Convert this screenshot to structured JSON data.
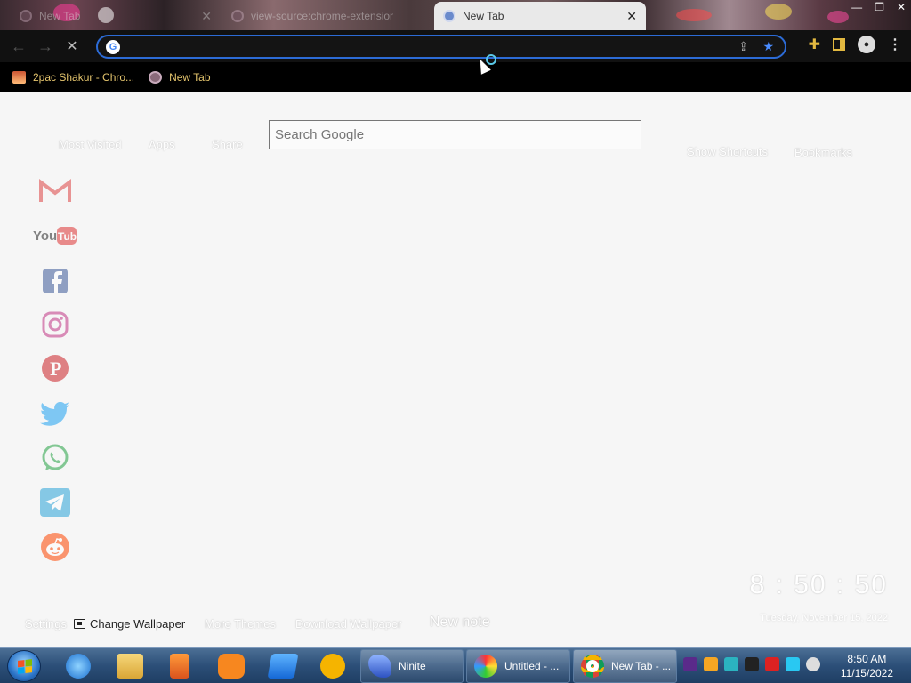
{
  "tabs": [
    {
      "label": "New Tab",
      "state": "inactive"
    },
    {
      "label": "view-source:chrome-extension://",
      "state": "inactive"
    },
    {
      "label": "New Tab",
      "state": "active"
    }
  ],
  "omnibox": {
    "value": "",
    "placeholder": ""
  },
  "bookmarks": [
    {
      "label": "2pac Shakur - Chro..."
    },
    {
      "label": "New Tab"
    }
  ],
  "page": {
    "top_links": {
      "most_visited": "Most Visited",
      "apps": "Apps",
      "share": "Share",
      "show_shortcuts": "Show Shortcuts",
      "bookmarks": "Bookmarks"
    },
    "search_placeholder": "Search Google",
    "social_icons": [
      "gmail-icon",
      "youtube-icon",
      "facebook-icon",
      "instagram-icon",
      "pinterest-icon",
      "twitter-icon",
      "whatsapp-icon",
      "telegram-icon",
      "reddit-icon"
    ],
    "footer": {
      "settings": "Settings",
      "change_wallpaper": "Change Wallpaper",
      "more_themes": "More Themes",
      "download_wallpaper": "Download Wallpaper",
      "new_note": "New note"
    },
    "clock": {
      "time": "8 : 50 : 50",
      "date": "Tuesday, November 15, 2022"
    }
  },
  "taskbar": {
    "tasks": [
      {
        "label": "Ninite"
      },
      {
        "label": "Untitled - ..."
      },
      {
        "label": "New Tab - ..."
      }
    ],
    "clock": {
      "time": "8:50 AM",
      "date": "11/15/2022"
    }
  },
  "colors": {
    "accent": "#2c6bd6",
    "bookmark_text": "#e6c66e",
    "toolbar_bg": "#111111",
    "page_bg": "#f6f6f6"
  }
}
